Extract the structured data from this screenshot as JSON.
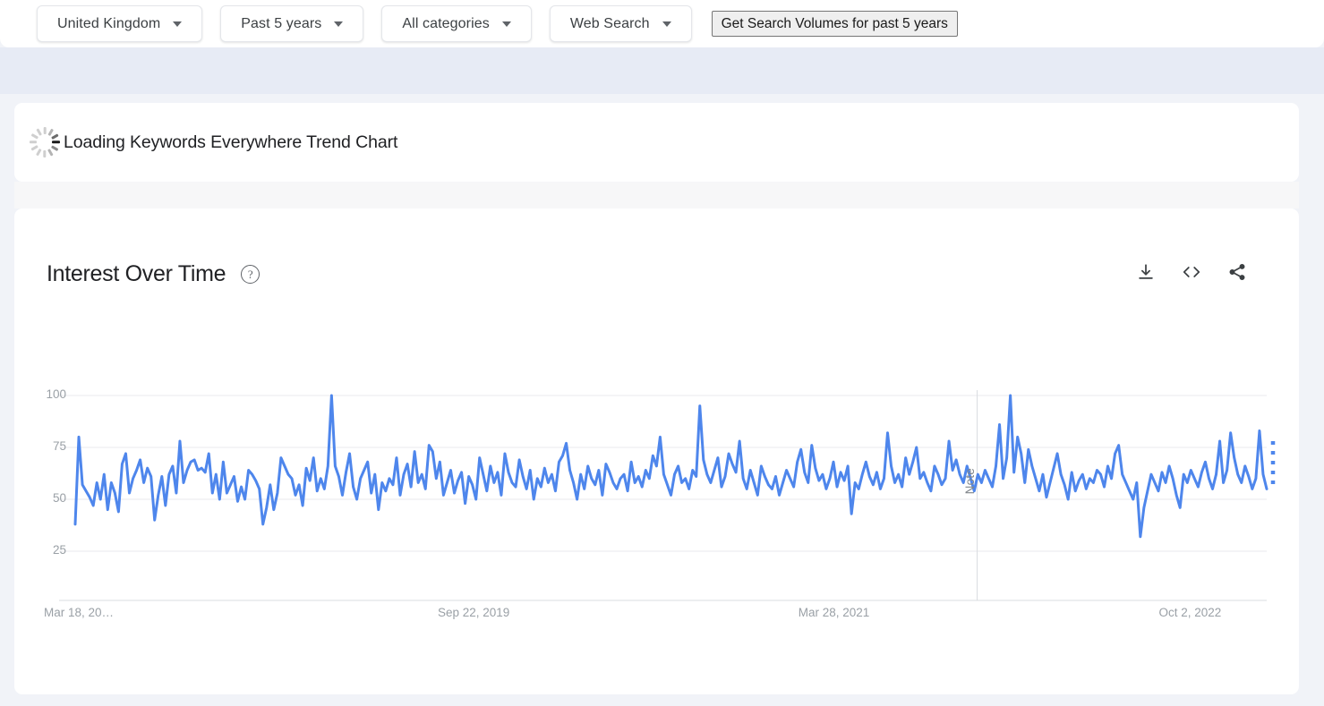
{
  "filter_bar": {
    "chips": [
      {
        "label": "United Kingdom",
        "icon": "chevron-down-icon",
        "name": "filter-region"
      },
      {
        "label": "Past 5 years",
        "icon": "chevron-down-icon",
        "name": "filter-time-range"
      },
      {
        "label": "All categories",
        "icon": "chevron-down-icon",
        "name": "filter-category"
      },
      {
        "label": "Web Search",
        "icon": "chevron-down-icon",
        "name": "filter-search-type"
      }
    ],
    "action_button": "Get Search Volumes for past 5 years"
  },
  "loading_panel": {
    "icon": "loading-spinner-icon",
    "text": "Loading Keywords Everywhere Trend Chart"
  },
  "chart_card": {
    "title": "Interest Over Time",
    "help_icon": "help-circle-icon",
    "help_glyph": "?",
    "actions": [
      {
        "name": "download-icon",
        "title": "Download"
      },
      {
        "name": "embed-code-icon",
        "title": "Embed"
      },
      {
        "name": "share-icon",
        "title": "Share"
      }
    ]
  },
  "chart_data": {
    "type": "line",
    "title": "Interest Over Time",
    "xlabel": "",
    "ylabel": "",
    "ylim": [
      0,
      105
    ],
    "yticks": [
      25,
      50,
      75,
      100
    ],
    "ytick_labels": [
      "25",
      "50",
      "75",
      "100"
    ],
    "grid": true,
    "legend": "none",
    "line_color": "#4e86ec",
    "line_width": 3,
    "annotations": [
      {
        "label": "Note",
        "type": "vertical-marker",
        "x_fraction": 0.757,
        "color": "#9aa0a6"
      }
    ],
    "partial_data_marker": {
      "style": "dotted",
      "position": "end",
      "color": "#4e86ec"
    },
    "xticks": [
      {
        "label": "Mar 18, 20…",
        "fraction": 0.0
      },
      {
        "label": "Sep 22, 2019",
        "fraction": 0.3065
      },
      {
        "label": "Mar 28, 2021",
        "fraction": 0.6091
      },
      {
        "label": "Oct 2, 2022",
        "fraction": 0.9117
      }
    ],
    "x_start": "Mar 18, 2018",
    "x_end": "Mar 2023",
    "series": [
      {
        "name": "Interest over time",
        "values": [
          38,
          80,
          57,
          54,
          51,
          47,
          58,
          50,
          62,
          45,
          58,
          53,
          44,
          67,
          72,
          53,
          60,
          64,
          69,
          58,
          65,
          61,
          40,
          52,
          61,
          47,
          62,
          66,
          53,
          78,
          58,
          64,
          68,
          69,
          64,
          65,
          63,
          72,
          53,
          62,
          50,
          68,
          53,
          57,
          61,
          49,
          56,
          50,
          64,
          62,
          59,
          55,
          38,
          46,
          57,
          45,
          53,
          70,
          66,
          62,
          60,
          52,
          57,
          47,
          65,
          59,
          70,
          54,
          60,
          55,
          66,
          100,
          66,
          61,
          52,
          63,
          72,
          56,
          50,
          60,
          64,
          68,
          53,
          62,
          45,
          58,
          54,
          60,
          57,
          70,
          52,
          62,
          67,
          56,
          73,
          58,
          62,
          55,
          76,
          73,
          60,
          68,
          52,
          58,
          64,
          53,
          59,
          63,
          48,
          61,
          57,
          50,
          70,
          62,
          54,
          66,
          58,
          63,
          52,
          72,
          63,
          58,
          56,
          69,
          61,
          55,
          64,
          50,
          60,
          56,
          65,
          58,
          62,
          54,
          68,
          71,
          77,
          64,
          58,
          50,
          62,
          55,
          66,
          60,
          57,
          64,
          52,
          67,
          63,
          58,
          55,
          60,
          62,
          54,
          68,
          58,
          61,
          56,
          64,
          60,
          71,
          66,
          80,
          62,
          57,
          52,
          62,
          66,
          58,
          60,
          55,
          64,
          61,
          95,
          69,
          62,
          58,
          64,
          70,
          56,
          61,
          72,
          67,
          63,
          78,
          60,
          55,
          64,
          58,
          52,
          66,
          61,
          57,
          55,
          61,
          52,
          58,
          64,
          60,
          56,
          68,
          74,
          63,
          58,
          76,
          65,
          59,
          62,
          55,
          60,
          68,
          56,
          63,
          59,
          66,
          43,
          58,
          55,
          62,
          68,
          61,
          57,
          63,
          55,
          60,
          82,
          66,
          58,
          62,
          56,
          70,
          62,
          68,
          75,
          60,
          63,
          58,
          54,
          66,
          62,
          57,
          60,
          78,
          64,
          69,
          62,
          58,
          66,
          60,
          54,
          62,
          58,
          64,
          60,
          56,
          66,
          86,
          60,
          70,
          100,
          63,
          80,
          72,
          58,
          74,
          66,
          60,
          54,
          62,
          51,
          58,
          65,
          72,
          62,
          57,
          50,
          63,
          54,
          59,
          62,
          55,
          60,
          58,
          64,
          62,
          56,
          66,
          60,
          72,
          76,
          62,
          58,
          54,
          50,
          58,
          32,
          46,
          54,
          62,
          58,
          54,
          63,
          58,
          66,
          60,
          52,
          46,
          62,
          58,
          64,
          60,
          56,
          63,
          68,
          60,
          55,
          62,
          78,
          58,
          64,
          82,
          70,
          62,
          58,
          66,
          61,
          55,
          60,
          83,
          62,
          55
        ]
      }
    ]
  }
}
